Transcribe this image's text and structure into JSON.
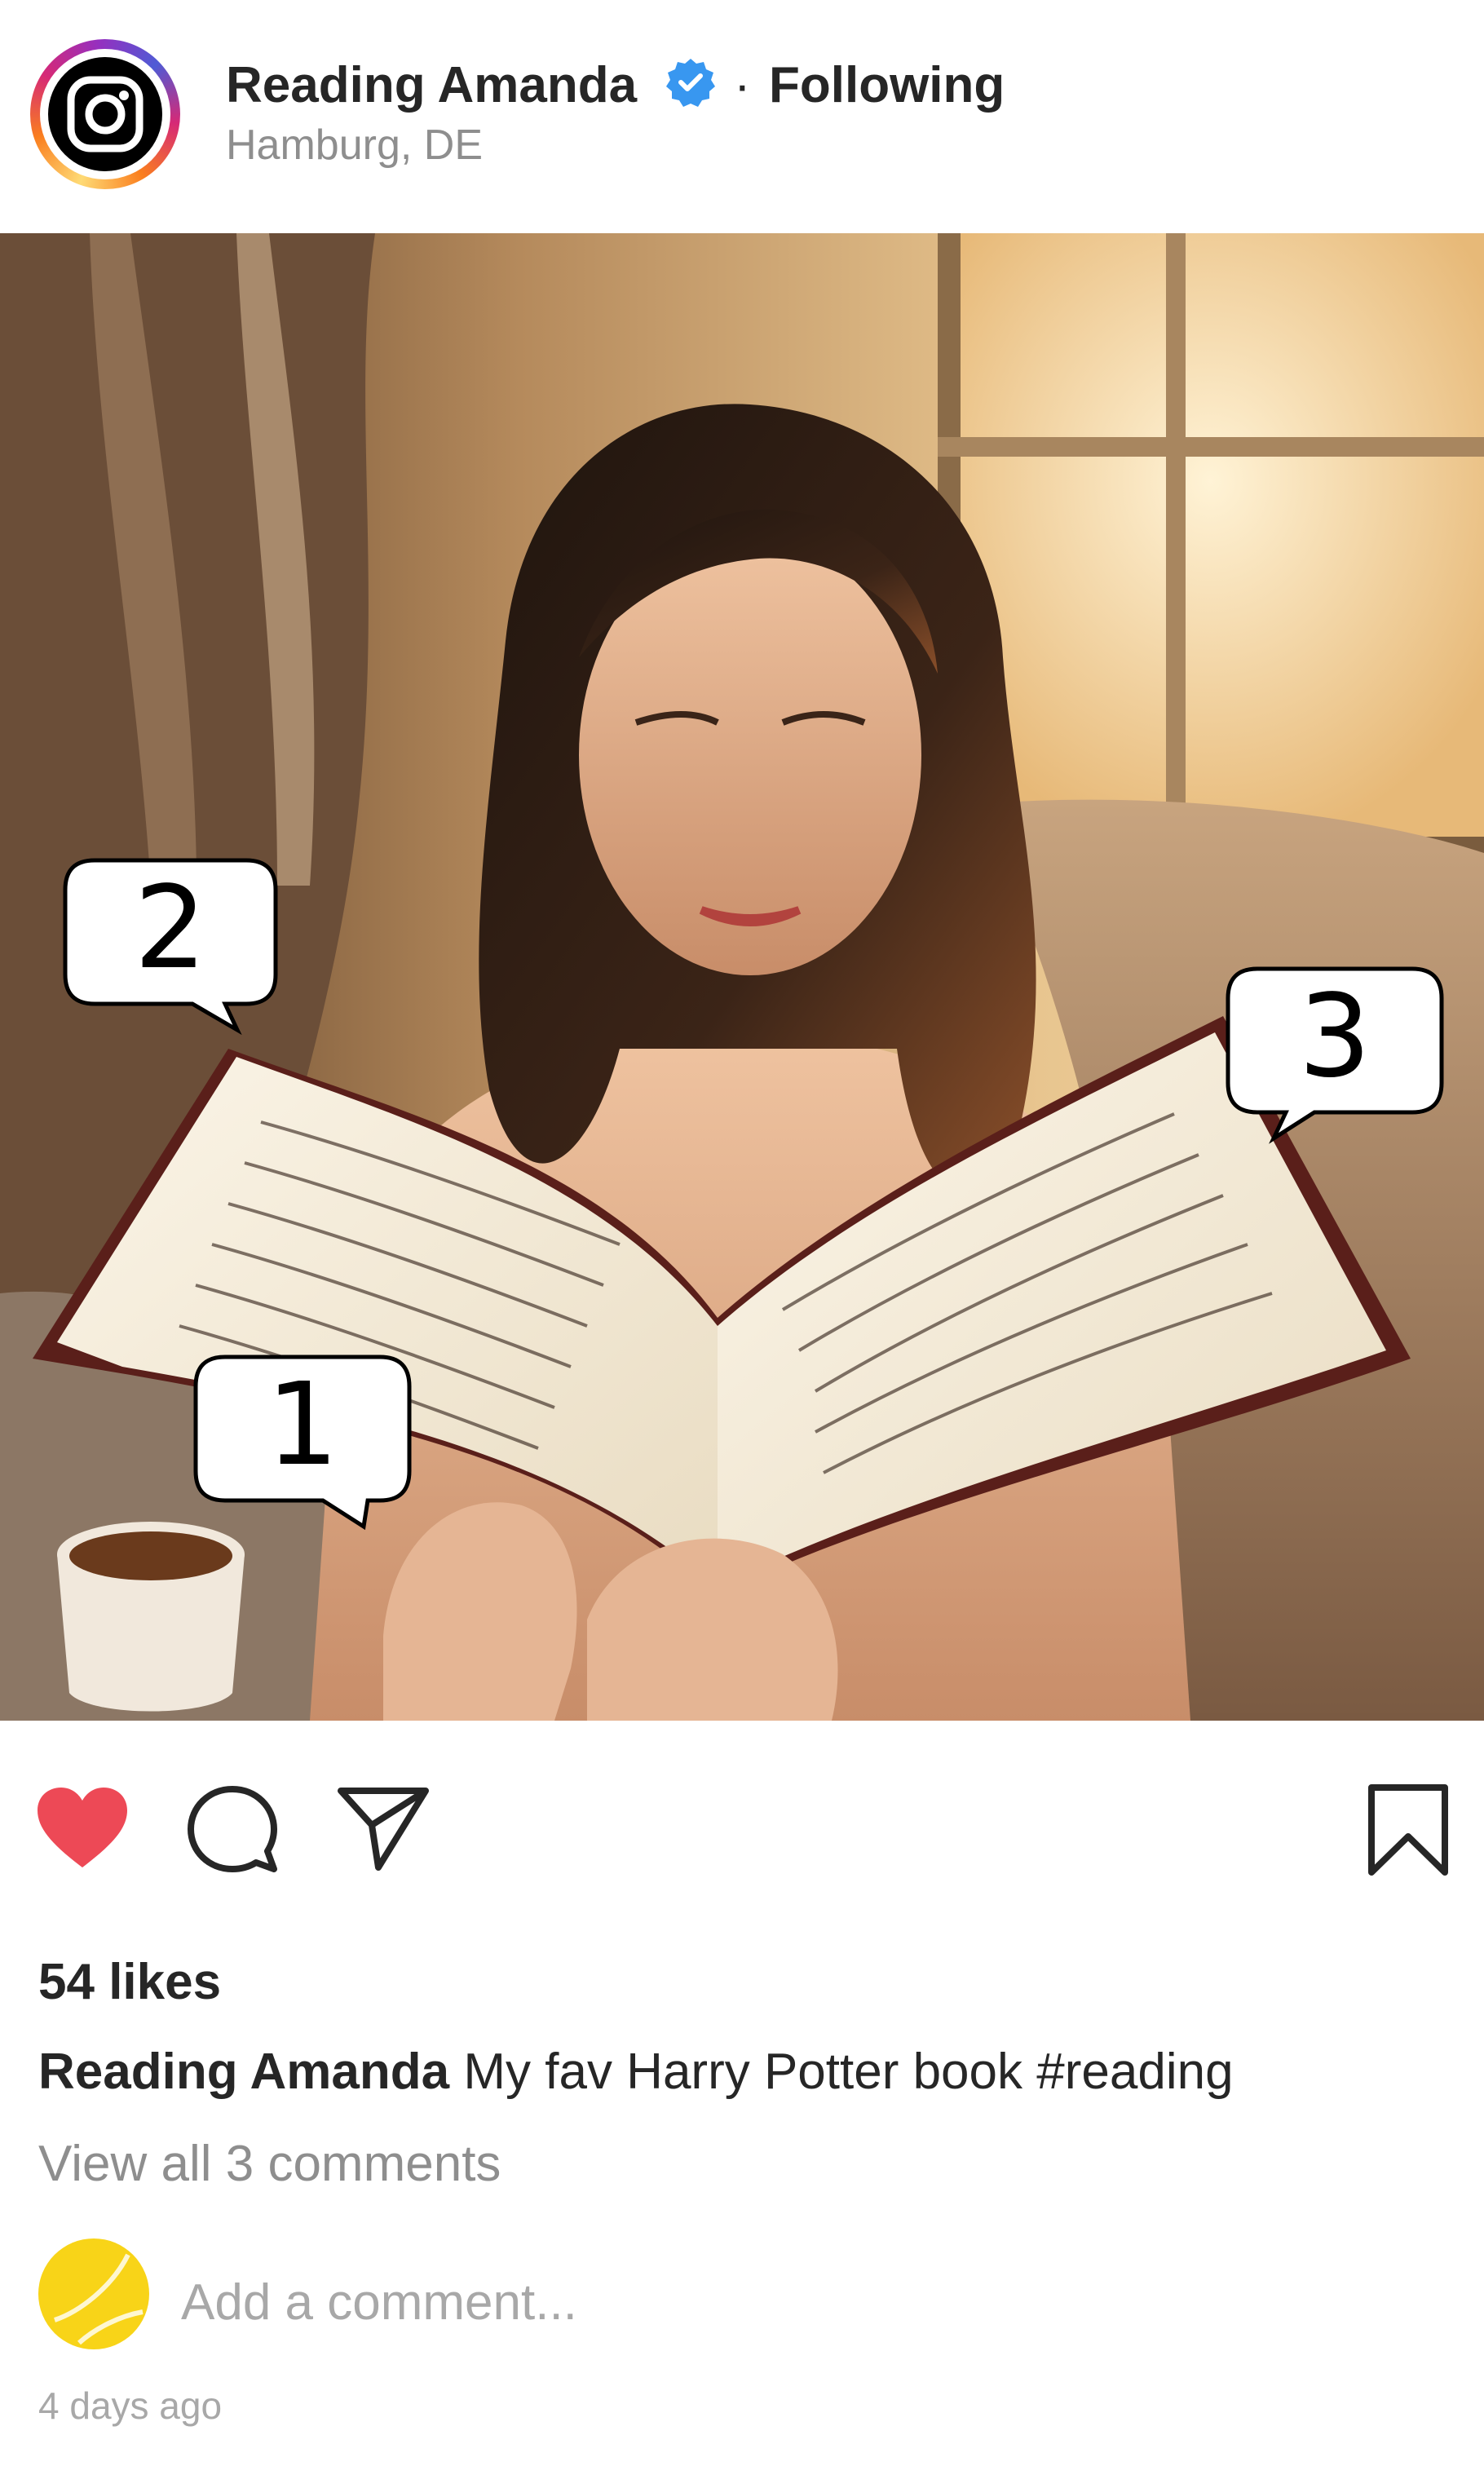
{
  "post": {
    "username": "Reading Amanda",
    "separator": "·",
    "follow_status": "Following",
    "location": "Hamburg, DE",
    "likes": "54 likes",
    "caption_user": "Reading Amanda",
    "caption_text": "My fav Harry Potter book #reading",
    "view_comments": "View all 3 comments",
    "add_comment_placeholder": "Add a comment...",
    "timestamp": "4 days ago",
    "liked": true
  },
  "callouts": [
    "1",
    "2",
    "3"
  ],
  "colors": {
    "heart": "#ed4956",
    "verified": "#3897f0",
    "secondary_text": "#8e8e8e",
    "commenter_avatar": "#f8d418"
  },
  "icons": {
    "profile": "instagram-glyph-icon",
    "verified": "verified-badge-icon",
    "like": "heart-icon",
    "comment": "comment-bubble-icon",
    "share": "paper-plane-icon",
    "save": "bookmark-icon"
  }
}
